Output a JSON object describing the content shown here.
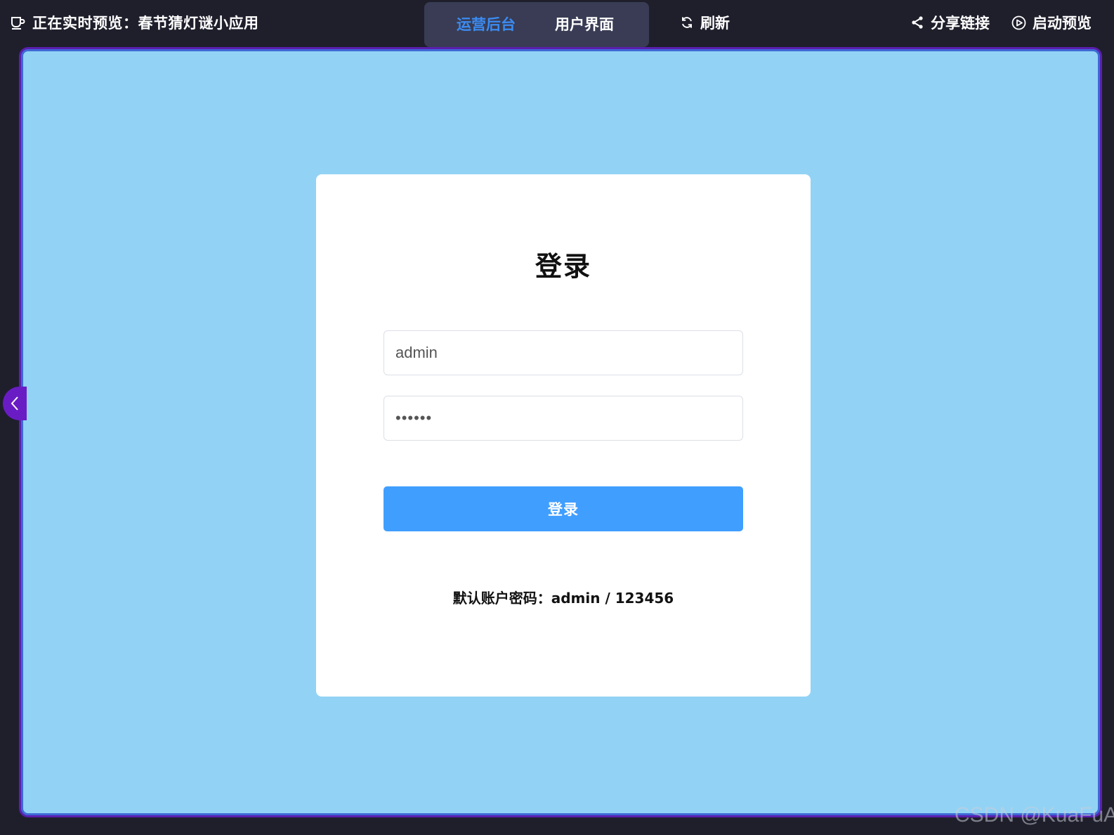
{
  "topbar": {
    "preview_title": "正在实时预览：春节猜灯谜小应用",
    "preview_icon": "cup-icon",
    "tabs": [
      {
        "label": "运营后台",
        "active": true
      },
      {
        "label": "用户界面",
        "active": false
      }
    ],
    "refresh_label": "刷新",
    "share_label": "分享链接",
    "launch_label": "启动预览"
  },
  "login": {
    "title": "登录",
    "username_value": "admin",
    "password_value": "123456",
    "submit_label": "登录",
    "hint": "默认账户密码：admin / 123456"
  },
  "colors": {
    "page_bg": "#1f1f2c",
    "frame_bg": "#92d3f5",
    "accent": "#3b8cf2",
    "button_bg": "#409eff",
    "handle": "#6a1cc4"
  },
  "watermark": "CSDN @KuaFuAI"
}
